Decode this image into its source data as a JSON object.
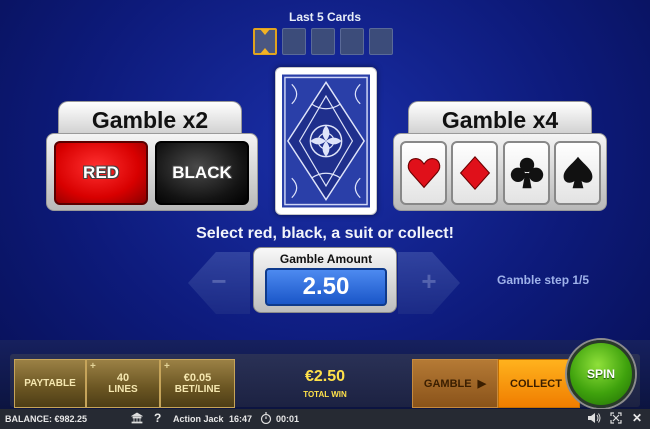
{
  "last_cards": {
    "title": "Last 5 Cards",
    "count": 5,
    "active_index": 0
  },
  "gamble_color": {
    "title": "Gamble x2",
    "red_label": "RED",
    "black_label": "BLACK"
  },
  "gamble_suit": {
    "title": "Gamble x4",
    "suits": [
      "hearts-icon",
      "diamonds-icon",
      "clubs-icon",
      "spades-icon"
    ]
  },
  "instruction": "Select red, black, a suit or collect!",
  "amount": {
    "label": "Gamble Amount",
    "value": "2.50",
    "minus": "−",
    "plus": "+"
  },
  "gamble_step": "Gamble step 1/5",
  "controls": {
    "paytable": "PAYTABLE",
    "lines_value": "40",
    "lines_label": "LINES",
    "bet_value": "€0.05",
    "bet_label": "BET/LINE",
    "win_value": "€2.50",
    "win_label": "TOTAL WIN",
    "gamble": "GAMBLE",
    "collect": "COLLECT",
    "spin": "SPIN"
  },
  "status": {
    "balance": "BALANCE: €982.25",
    "game_name": "Action Jack",
    "clock": "16:47",
    "session_time": "00:01"
  },
  "colors": {
    "accent_gold": "#f3b224",
    "amount_blue": "#1a56c8",
    "collect_orange": "#f07d00",
    "spin_green": "#3fa20d"
  }
}
